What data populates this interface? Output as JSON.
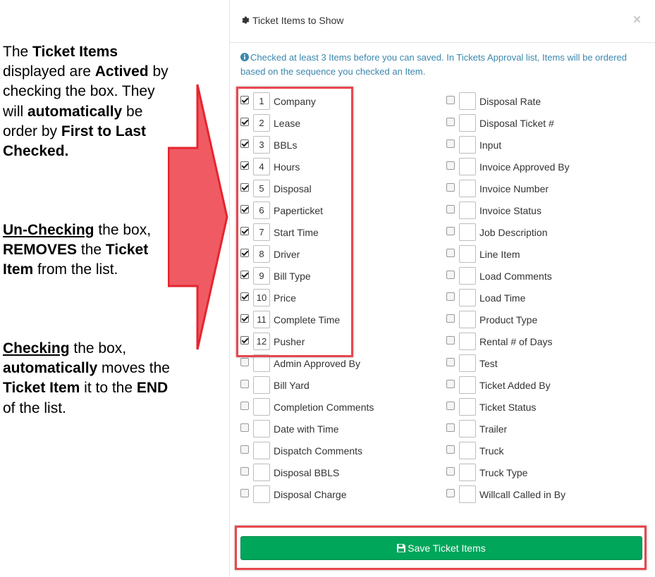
{
  "annotations": {
    "para1": [
      {
        "t": "The ",
        "b": false,
        "u": false
      },
      {
        "t": "Ticket Items",
        "b": true,
        "u": false
      },
      {
        "t": " displayed are ",
        "b": false,
        "u": false
      },
      {
        "t": "Actived",
        "b": true,
        "u": false
      },
      {
        "t": " by checking the box.  They will ",
        "b": false,
        "u": false
      },
      {
        "t": "automatically",
        "b": true,
        "u": false
      },
      {
        "t": " be order by ",
        "b": false,
        "u": false
      },
      {
        "t": "First to Last Checked.",
        "b": true,
        "u": false
      }
    ],
    "para2": [
      {
        "t": "Un-Checking",
        "b": true,
        "u": true
      },
      {
        "t": " the box, ",
        "b": false,
        "u": false
      },
      {
        "t": "REMOVES",
        "b": true,
        "u": false
      },
      {
        "t": " the ",
        "b": false,
        "u": false
      },
      {
        "t": "Ticket Item",
        "b": true,
        "u": false
      },
      {
        "t": " from the list.",
        "b": false,
        "u": false
      }
    ],
    "para3": [
      {
        "t": "Checking",
        "b": true,
        "u": true
      },
      {
        "t": " the box, ",
        "b": false,
        "u": false
      },
      {
        "t": "automatically",
        "b": true,
        "u": false
      },
      {
        "t": " moves the ",
        "b": false,
        "u": false
      },
      {
        "t": "Ticket Item",
        "b": true,
        "u": false
      },
      {
        "t": " it to the ",
        "b": false,
        "u": false
      },
      {
        "t": "END",
        "b": true,
        "u": false
      },
      {
        "t": " of the list.",
        "b": false,
        "u": false
      }
    ]
  },
  "colors": {
    "highlight": "#e8464e",
    "arrow_fill": "#f05a63",
    "save_button": "#00a65a",
    "info_text": "#3a87ad"
  },
  "modal": {
    "title": "Ticket Items to Show",
    "title_icon": "gear-icon",
    "close_label": "×",
    "notice_icon": "info-circle-icon",
    "notice": "Checked at least 3 Items before you can saved. In Tickets Approval list, Items will be ordered based on the sequence you checked an Item.",
    "save_icon": "floppy-disk-icon",
    "save_label": "Save Ticket Items"
  },
  "items_left": [
    {
      "label": "Company",
      "checked": true,
      "order": "1"
    },
    {
      "label": "Lease",
      "checked": true,
      "order": "2"
    },
    {
      "label": "BBLs",
      "checked": true,
      "order": "3"
    },
    {
      "label": "Hours",
      "checked": true,
      "order": "4"
    },
    {
      "label": "Disposal",
      "checked": true,
      "order": "5"
    },
    {
      "label": "Paperticket",
      "checked": true,
      "order": "6"
    },
    {
      "label": "Start Time",
      "checked": true,
      "order": "7"
    },
    {
      "label": "Driver",
      "checked": true,
      "order": "8"
    },
    {
      "label": "Bill Type",
      "checked": true,
      "order": "9"
    },
    {
      "label": "Price",
      "checked": true,
      "order": "10"
    },
    {
      "label": "Complete Time",
      "checked": true,
      "order": "11"
    },
    {
      "label": "Pusher",
      "checked": true,
      "order": "12"
    },
    {
      "label": "Admin Approved By",
      "checked": false,
      "order": ""
    },
    {
      "label": "Bill Yard",
      "checked": false,
      "order": ""
    },
    {
      "label": "Completion Comments",
      "checked": false,
      "order": ""
    },
    {
      "label": "Date with Time",
      "checked": false,
      "order": ""
    },
    {
      "label": "Dispatch Comments",
      "checked": false,
      "order": ""
    },
    {
      "label": "Disposal BBLS",
      "checked": false,
      "order": ""
    },
    {
      "label": "Disposal Charge",
      "checked": false,
      "order": ""
    }
  ],
  "items_right": [
    {
      "label": "Disposal Rate",
      "checked": false,
      "order": ""
    },
    {
      "label": "Disposal Ticket #",
      "checked": false,
      "order": ""
    },
    {
      "label": "Input",
      "checked": false,
      "order": ""
    },
    {
      "label": "Invoice Approved By",
      "checked": false,
      "order": ""
    },
    {
      "label": "Invoice Number",
      "checked": false,
      "order": ""
    },
    {
      "label": "Invoice Status",
      "checked": false,
      "order": ""
    },
    {
      "label": "Job Description",
      "checked": false,
      "order": ""
    },
    {
      "label": "Line Item",
      "checked": false,
      "order": ""
    },
    {
      "label": "Load Comments",
      "checked": false,
      "order": ""
    },
    {
      "label": "Load Time",
      "checked": false,
      "order": ""
    },
    {
      "label": "Product Type",
      "checked": false,
      "order": ""
    },
    {
      "label": "Rental # of Days",
      "checked": false,
      "order": ""
    },
    {
      "label": "Test",
      "checked": false,
      "order": ""
    },
    {
      "label": "Ticket Added By",
      "checked": false,
      "order": ""
    },
    {
      "label": "Ticket Status",
      "checked": false,
      "order": ""
    },
    {
      "label": "Trailer",
      "checked": false,
      "order": ""
    },
    {
      "label": "Truck",
      "checked": false,
      "order": ""
    },
    {
      "label": "Truck Type",
      "checked": false,
      "order": ""
    },
    {
      "label": "Willcall Called in By",
      "checked": false,
      "order": ""
    }
  ]
}
